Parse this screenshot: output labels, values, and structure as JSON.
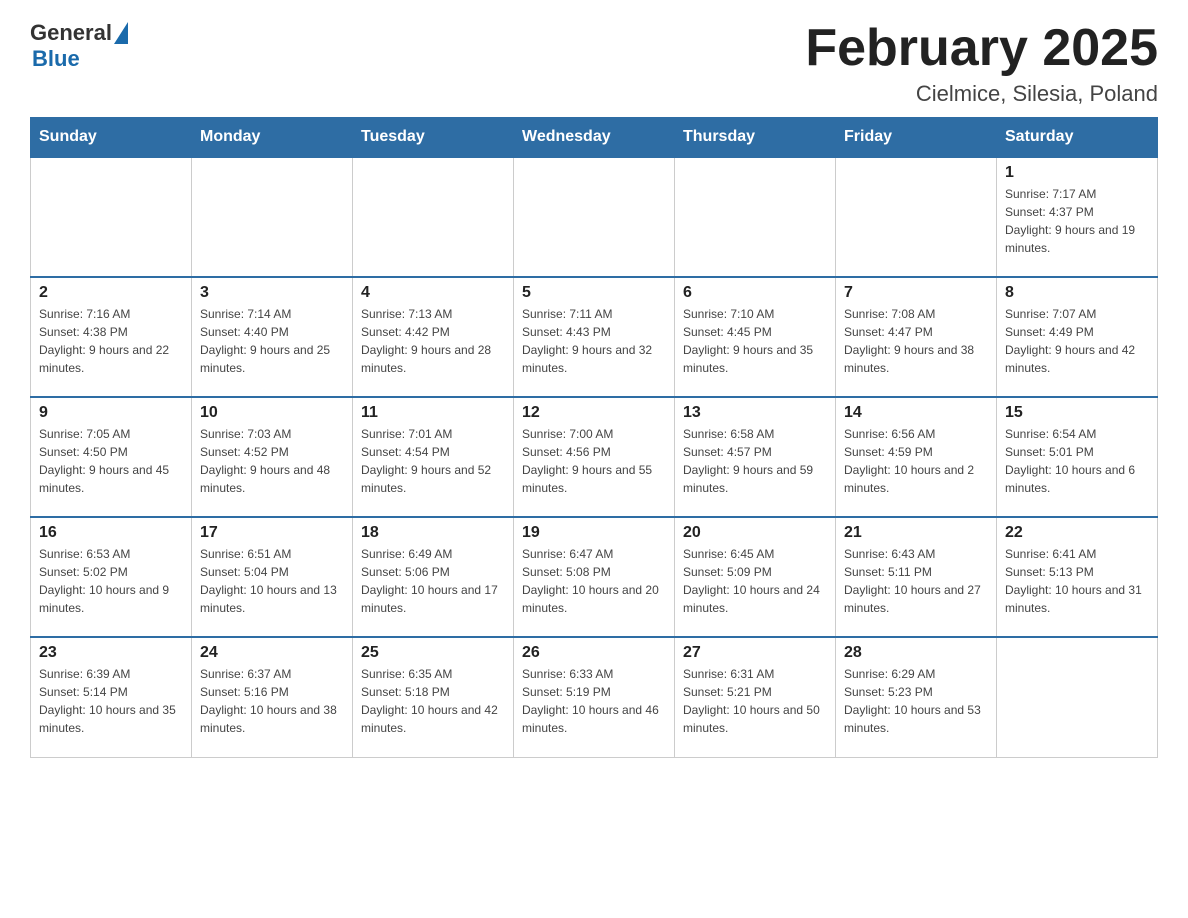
{
  "header": {
    "logo_general": "General",
    "logo_blue": "Blue",
    "title": "February 2025",
    "subtitle": "Cielmice, Silesia, Poland"
  },
  "days_of_week": [
    "Sunday",
    "Monday",
    "Tuesday",
    "Wednesday",
    "Thursday",
    "Friday",
    "Saturday"
  ],
  "weeks": [
    [
      {
        "day": "",
        "sunrise": "",
        "sunset": "",
        "daylight": ""
      },
      {
        "day": "",
        "sunrise": "",
        "sunset": "",
        "daylight": ""
      },
      {
        "day": "",
        "sunrise": "",
        "sunset": "",
        "daylight": ""
      },
      {
        "day": "",
        "sunrise": "",
        "sunset": "",
        "daylight": ""
      },
      {
        "day": "",
        "sunrise": "",
        "sunset": "",
        "daylight": ""
      },
      {
        "day": "",
        "sunrise": "",
        "sunset": "",
        "daylight": ""
      },
      {
        "day": "1",
        "sunrise": "Sunrise: 7:17 AM",
        "sunset": "Sunset: 4:37 PM",
        "daylight": "Daylight: 9 hours and 19 minutes."
      }
    ],
    [
      {
        "day": "2",
        "sunrise": "Sunrise: 7:16 AM",
        "sunset": "Sunset: 4:38 PM",
        "daylight": "Daylight: 9 hours and 22 minutes."
      },
      {
        "day": "3",
        "sunrise": "Sunrise: 7:14 AM",
        "sunset": "Sunset: 4:40 PM",
        "daylight": "Daylight: 9 hours and 25 minutes."
      },
      {
        "day": "4",
        "sunrise": "Sunrise: 7:13 AM",
        "sunset": "Sunset: 4:42 PM",
        "daylight": "Daylight: 9 hours and 28 minutes."
      },
      {
        "day": "5",
        "sunrise": "Sunrise: 7:11 AM",
        "sunset": "Sunset: 4:43 PM",
        "daylight": "Daylight: 9 hours and 32 minutes."
      },
      {
        "day": "6",
        "sunrise": "Sunrise: 7:10 AM",
        "sunset": "Sunset: 4:45 PM",
        "daylight": "Daylight: 9 hours and 35 minutes."
      },
      {
        "day": "7",
        "sunrise": "Sunrise: 7:08 AM",
        "sunset": "Sunset: 4:47 PM",
        "daylight": "Daylight: 9 hours and 38 minutes."
      },
      {
        "day": "8",
        "sunrise": "Sunrise: 7:07 AM",
        "sunset": "Sunset: 4:49 PM",
        "daylight": "Daylight: 9 hours and 42 minutes."
      }
    ],
    [
      {
        "day": "9",
        "sunrise": "Sunrise: 7:05 AM",
        "sunset": "Sunset: 4:50 PM",
        "daylight": "Daylight: 9 hours and 45 minutes."
      },
      {
        "day": "10",
        "sunrise": "Sunrise: 7:03 AM",
        "sunset": "Sunset: 4:52 PM",
        "daylight": "Daylight: 9 hours and 48 minutes."
      },
      {
        "day": "11",
        "sunrise": "Sunrise: 7:01 AM",
        "sunset": "Sunset: 4:54 PM",
        "daylight": "Daylight: 9 hours and 52 minutes."
      },
      {
        "day": "12",
        "sunrise": "Sunrise: 7:00 AM",
        "sunset": "Sunset: 4:56 PM",
        "daylight": "Daylight: 9 hours and 55 minutes."
      },
      {
        "day": "13",
        "sunrise": "Sunrise: 6:58 AM",
        "sunset": "Sunset: 4:57 PM",
        "daylight": "Daylight: 9 hours and 59 minutes."
      },
      {
        "day": "14",
        "sunrise": "Sunrise: 6:56 AM",
        "sunset": "Sunset: 4:59 PM",
        "daylight": "Daylight: 10 hours and 2 minutes."
      },
      {
        "day": "15",
        "sunrise": "Sunrise: 6:54 AM",
        "sunset": "Sunset: 5:01 PM",
        "daylight": "Daylight: 10 hours and 6 minutes."
      }
    ],
    [
      {
        "day": "16",
        "sunrise": "Sunrise: 6:53 AM",
        "sunset": "Sunset: 5:02 PM",
        "daylight": "Daylight: 10 hours and 9 minutes."
      },
      {
        "day": "17",
        "sunrise": "Sunrise: 6:51 AM",
        "sunset": "Sunset: 5:04 PM",
        "daylight": "Daylight: 10 hours and 13 minutes."
      },
      {
        "day": "18",
        "sunrise": "Sunrise: 6:49 AM",
        "sunset": "Sunset: 5:06 PM",
        "daylight": "Daylight: 10 hours and 17 minutes."
      },
      {
        "day": "19",
        "sunrise": "Sunrise: 6:47 AM",
        "sunset": "Sunset: 5:08 PM",
        "daylight": "Daylight: 10 hours and 20 minutes."
      },
      {
        "day": "20",
        "sunrise": "Sunrise: 6:45 AM",
        "sunset": "Sunset: 5:09 PM",
        "daylight": "Daylight: 10 hours and 24 minutes."
      },
      {
        "day": "21",
        "sunrise": "Sunrise: 6:43 AM",
        "sunset": "Sunset: 5:11 PM",
        "daylight": "Daylight: 10 hours and 27 minutes."
      },
      {
        "day": "22",
        "sunrise": "Sunrise: 6:41 AM",
        "sunset": "Sunset: 5:13 PM",
        "daylight": "Daylight: 10 hours and 31 minutes."
      }
    ],
    [
      {
        "day": "23",
        "sunrise": "Sunrise: 6:39 AM",
        "sunset": "Sunset: 5:14 PM",
        "daylight": "Daylight: 10 hours and 35 minutes."
      },
      {
        "day": "24",
        "sunrise": "Sunrise: 6:37 AM",
        "sunset": "Sunset: 5:16 PM",
        "daylight": "Daylight: 10 hours and 38 minutes."
      },
      {
        "day": "25",
        "sunrise": "Sunrise: 6:35 AM",
        "sunset": "Sunset: 5:18 PM",
        "daylight": "Daylight: 10 hours and 42 minutes."
      },
      {
        "day": "26",
        "sunrise": "Sunrise: 6:33 AM",
        "sunset": "Sunset: 5:19 PM",
        "daylight": "Daylight: 10 hours and 46 minutes."
      },
      {
        "day": "27",
        "sunrise": "Sunrise: 6:31 AM",
        "sunset": "Sunset: 5:21 PM",
        "daylight": "Daylight: 10 hours and 50 minutes."
      },
      {
        "day": "28",
        "sunrise": "Sunrise: 6:29 AM",
        "sunset": "Sunset: 5:23 PM",
        "daylight": "Daylight: 10 hours and 53 minutes."
      },
      {
        "day": "",
        "sunrise": "",
        "sunset": "",
        "daylight": ""
      }
    ]
  ]
}
